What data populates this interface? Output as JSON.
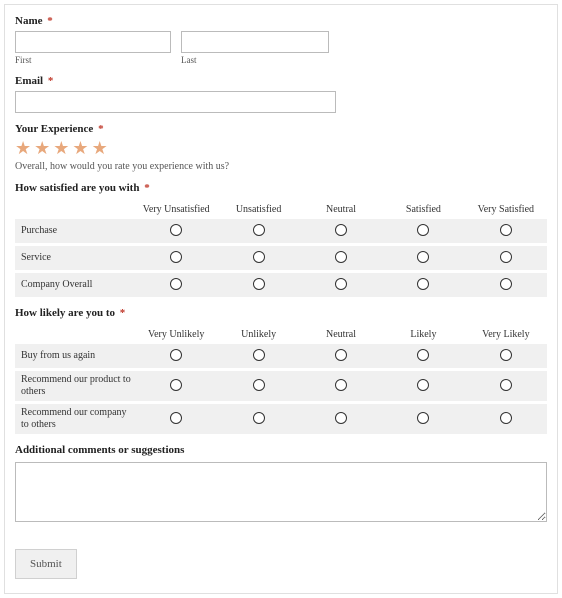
{
  "name": {
    "label": "Name",
    "first_sub": "First",
    "last_sub": "Last"
  },
  "email": {
    "label": "Email"
  },
  "experience": {
    "label": "Your Experience",
    "helper": "Overall, how would you rate you experience with us?"
  },
  "satisfaction": {
    "label": "How satisfied are you with",
    "cols": [
      "Very Unsatisfied",
      "Unsatisfied",
      "Neutral",
      "Satisfied",
      "Very Satisfied"
    ],
    "rows": [
      "Purchase",
      "Service",
      "Company Overall"
    ]
  },
  "likelihood": {
    "label": "How likely are you to",
    "cols": [
      "Very Unlikely",
      "Unlikely",
      "Neutral",
      "Likely",
      "Very Likely"
    ],
    "rows": [
      "Buy from us again",
      "Recommend our product to others",
      "Recommend our company to others"
    ]
  },
  "comments": {
    "label": "Additional comments or suggestions"
  },
  "submit": {
    "label": "Submit"
  },
  "asterisk": "*"
}
